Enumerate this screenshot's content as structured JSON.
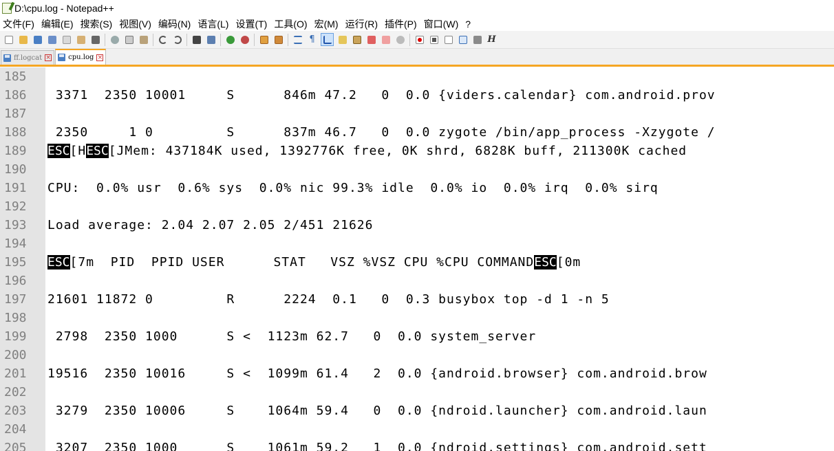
{
  "window": {
    "title": "D:\\cpu.log - Notepad++"
  },
  "menu": [
    "文件(F)",
    "编辑(E)",
    "搜索(S)",
    "视图(V)",
    "编码(N)",
    "语言(L)",
    "设置(T)",
    "工具(O)",
    "宏(M)",
    "运行(R)",
    "插件(P)",
    "窗口(W)",
    "?"
  ],
  "toolbar": {
    "h_label": "H"
  },
  "tabs": [
    {
      "label": "ff.logcat",
      "active": false
    },
    {
      "label": "cpu.log",
      "active": true
    }
  ],
  "close_glyph": "×",
  "editor": {
    "lines": [
      {
        "n": "185",
        "segs": []
      },
      {
        "n": "186",
        "segs": [
          {
            "t": " 3371  2350 10001     S      846m 47.2   0  0.0 {viders.calendar} com.android.prov"
          }
        ]
      },
      {
        "n": "187",
        "segs": []
      },
      {
        "n": "188",
        "segs": [
          {
            "t": " 2350     1 0         S      837m 46.7   0  0.0 zygote /bin/app_process -Xzygote /"
          }
        ]
      },
      {
        "n": "189",
        "segs": [
          {
            "t": "ESC",
            "esc": true
          },
          {
            "t": "[H"
          },
          {
            "t": "ESC",
            "esc": true
          },
          {
            "t": "[JMem: 437184K used, 1392776K free, 0K shrd, 6828K buff, 211300K cached"
          }
        ]
      },
      {
        "n": "190",
        "segs": []
      },
      {
        "n": "191",
        "segs": [
          {
            "t": "CPU:  0.0% usr  0.6% sys  0.0% nic 99.3% idle  0.0% io  0.0% irq  0.0% sirq"
          }
        ]
      },
      {
        "n": "192",
        "segs": []
      },
      {
        "n": "193",
        "segs": [
          {
            "t": "Load average: 2.04 2.07 2.05 2/451 21626"
          }
        ]
      },
      {
        "n": "194",
        "segs": []
      },
      {
        "n": "195",
        "segs": [
          {
            "t": "ESC",
            "esc": true
          },
          {
            "t": "[7m  PID  PPID USER      STAT   VSZ %VSZ CPU %CPU COMMAND"
          },
          {
            "t": "ESC",
            "esc": true
          },
          {
            "t": "[0m"
          }
        ]
      },
      {
        "n": "196",
        "segs": []
      },
      {
        "n": "197",
        "segs": [
          {
            "t": "21601 11872 0         R      2224  0.1   0  0.3 busybox top -d 1 -n 5"
          }
        ]
      },
      {
        "n": "198",
        "segs": []
      },
      {
        "n": "199",
        "segs": [
          {
            "t": " 2798  2350 1000      S <  1123m 62.7   0  0.0 system_server"
          }
        ]
      },
      {
        "n": "200",
        "segs": []
      },
      {
        "n": "201",
        "segs": [
          {
            "t": "19516  2350 10016     S <  1099m 61.4   2  0.0 {android.browser} com.android.brow"
          }
        ]
      },
      {
        "n": "202",
        "segs": []
      },
      {
        "n": "203",
        "segs": [
          {
            "t": " 3279  2350 10006     S    1064m 59.4   0  0.0 {ndroid.launcher} com.android.laun"
          }
        ]
      },
      {
        "n": "204",
        "segs": []
      },
      {
        "n": "205",
        "segs": [
          {
            "t": " 3207  2350 1000      S    1061m 59.2   1  0.0 {ndroid.settings} com.android.sett"
          }
        ]
      }
    ]
  }
}
